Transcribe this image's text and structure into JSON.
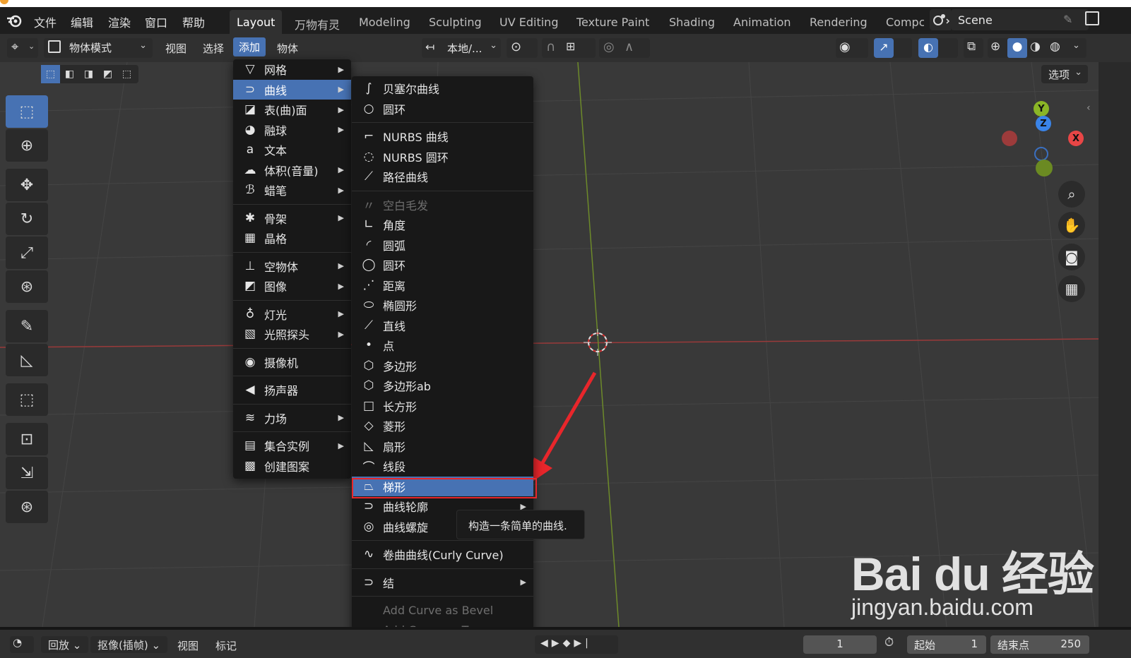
{
  "app": {
    "menus": [
      "文件",
      "编辑",
      "渲染",
      "窗口",
      "帮助"
    ],
    "workspaces": [
      "Layout",
      "万物有灵",
      "Modeling",
      "Sculpting",
      "UV Editing",
      "Texture Paint",
      "Shading",
      "Animation",
      "Rendering",
      "Compc"
    ],
    "active_workspace": "Layout",
    "scene": "Scene"
  },
  "header": {
    "mode": "物体模式",
    "view": "视图",
    "select": "选择",
    "add": "添加",
    "object": "物体",
    "transform_orientation": "本地/...",
    "options": "选项"
  },
  "add_menu": {
    "items": [
      {
        "label": "网格",
        "icon": "mesh-icon",
        "glyph": "▽",
        "submenu": true
      },
      {
        "label": "曲线",
        "icon": "curve-icon",
        "glyph": "⊃",
        "submenu": true,
        "highlighted": true
      },
      {
        "label": "表(曲)面",
        "icon": "surface-icon",
        "glyph": "◪",
        "submenu": true
      },
      {
        "label": "融球",
        "icon": "metaball-icon",
        "glyph": "◕",
        "submenu": true
      },
      {
        "label": "文本",
        "icon": "text-icon",
        "glyph": "a",
        "submenu": false
      },
      {
        "label": "体积(音量)",
        "icon": "volume-icon",
        "glyph": "☁",
        "submenu": true
      },
      {
        "label": "蜡笔",
        "icon": "grease-pencil-icon",
        "glyph": "ℬ",
        "submenu": true,
        "sep_after": true
      },
      {
        "label": "骨架",
        "icon": "armature-icon",
        "glyph": "✱",
        "submenu": true
      },
      {
        "label": "晶格",
        "icon": "lattice-icon",
        "glyph": "▦",
        "submenu": false,
        "sep_after": true
      },
      {
        "label": "空物体",
        "icon": "empty-icon",
        "glyph": "⊥",
        "submenu": true
      },
      {
        "label": "图像",
        "icon": "image-icon",
        "glyph": "◩",
        "submenu": true,
        "sep_after": true
      },
      {
        "label": "灯光",
        "icon": "light-icon",
        "glyph": "♁",
        "submenu": true
      },
      {
        "label": "光照探头",
        "icon": "light-probe-icon",
        "glyph": "▧",
        "submenu": true,
        "sep_after": true
      },
      {
        "label": "摄像机",
        "icon": "camera-icon",
        "glyph": "◉",
        "submenu": false,
        "sep_after": true
      },
      {
        "label": "扬声器",
        "icon": "speaker-icon",
        "glyph": "◀",
        "submenu": false,
        "sep_after": true
      },
      {
        "label": "力场",
        "icon": "force-field-icon",
        "glyph": "≋",
        "submenu": true,
        "sep_after": true
      },
      {
        "label": "集合实例",
        "icon": "collection-instance-icon",
        "glyph": "▤",
        "submenu": true
      },
      {
        "label": "创建图案",
        "icon": "create-pattern-icon",
        "glyph": "▩",
        "submenu": false
      }
    ]
  },
  "curve_menu": {
    "items": [
      {
        "label": "贝塞尔曲线",
        "icon": "bezier-curve-icon",
        "glyph": "∫"
      },
      {
        "label": "圆环",
        "icon": "bezier-circle-icon",
        "glyph": "○",
        "sep_after": true
      },
      {
        "label": "NURBS 曲线",
        "icon": "nurbs-curve-icon",
        "glyph": "⌐"
      },
      {
        "label": "NURBS 圆环",
        "icon": "nurbs-circle-icon",
        "glyph": "◌"
      },
      {
        "label": "路径曲线",
        "icon": "path-curve-icon",
        "glyph": "⟋",
        "sep_after": true
      },
      {
        "label": "空白毛发",
        "icon": "empty-hair-icon",
        "glyph": "〃",
        "disabled": true
      },
      {
        "label": "角度",
        "icon": "angle-icon",
        "glyph": "∟"
      },
      {
        "label": "圆弧",
        "icon": "arc-icon",
        "glyph": "◜"
      },
      {
        "label": "圆环",
        "icon": "circle-icon",
        "glyph": "◯"
      },
      {
        "label": "距离",
        "icon": "distance-icon",
        "glyph": "⋰"
      },
      {
        "label": "椭圆形",
        "icon": "ellipse-icon",
        "glyph": "⬭"
      },
      {
        "label": "直线",
        "icon": "line-icon",
        "glyph": "⟋"
      },
      {
        "label": "点",
        "icon": "point-icon",
        "glyph": "•"
      },
      {
        "label": "多边形",
        "icon": "polygon-icon",
        "glyph": "⬡"
      },
      {
        "label": "多边形ab",
        "icon": "polygon-ab-icon",
        "glyph": "⬡"
      },
      {
        "label": "长方形",
        "icon": "rectangle-icon",
        "glyph": "□"
      },
      {
        "label": "菱形",
        "icon": "rhomb-icon",
        "glyph": "◇"
      },
      {
        "label": "扇形",
        "icon": "sector-icon",
        "glyph": "◺"
      },
      {
        "label": "线段",
        "icon": "segment-icon",
        "glyph": "⌒"
      },
      {
        "label": "梯形",
        "icon": "trapezoid-icon",
        "glyph": "⏢",
        "highlighted": true
      },
      {
        "label": "曲线轮廓",
        "icon": "curve-profile-icon",
        "glyph": "⊃",
        "submenu": true
      },
      {
        "label": "曲线螺旋",
        "icon": "curve-spiral-icon",
        "glyph": "◎",
        "sep_after": true
      },
      {
        "label": "卷曲曲线(Curly Curve)",
        "icon": "curly-curve-icon",
        "glyph": "∿",
        "sep_after": true
      },
      {
        "label": "结",
        "icon": "knot-icon",
        "glyph": "⊃",
        "submenu": true,
        "sep_after": true
      },
      {
        "label": "Add Curve as Bevel",
        "icon": "",
        "glyph": "",
        "disabled": true
      },
      {
        "label": "Add Curve as Taper",
        "icon": "",
        "glyph": "",
        "disabled": true
      }
    ]
  },
  "tooltip": "构造一条简单的曲线.",
  "gizmo": {
    "x": "X",
    "y": "Y",
    "z": "Z"
  },
  "watermark": {
    "brand": "Bai du 经验",
    "url": "jingyan.baidu.com"
  },
  "timeline": {
    "playback": "回放",
    "keying": "抠像(插帧)",
    "view": "视图",
    "marker": "标记",
    "current_frame": "1",
    "start_label": "起始",
    "start": "1",
    "end_label": "结束点",
    "end": "250"
  },
  "colors": {
    "accent": "#4772b3",
    "highlight_box": "#e8262b",
    "x_axis": "#e84646",
    "y_axis": "#8ab526",
    "z_axis": "#3a84e8"
  }
}
